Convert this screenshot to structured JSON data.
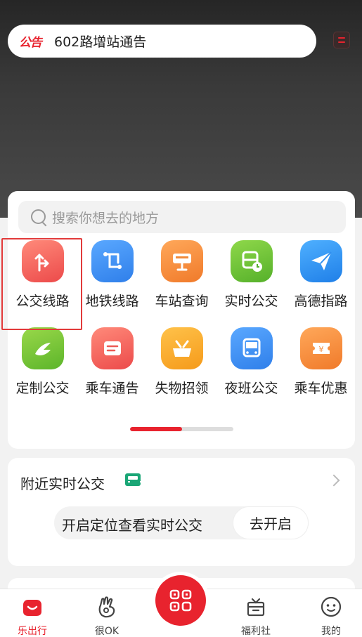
{
  "notice": {
    "tag": "公告",
    "text": "602路增站通告"
  },
  "search": {
    "placeholder": "搜索你想去的地方"
  },
  "services": [
    {
      "label": "公交线路",
      "icon": "route-icon",
      "color": "#f0605c"
    },
    {
      "label": "地铁线路",
      "icon": "metro-icon",
      "color": "#3f8ff0"
    },
    {
      "label": "车站查询",
      "icon": "station-icon",
      "color": "#f58a3a"
    },
    {
      "label": "实时公交",
      "icon": "realtime-bus-icon",
      "color": "#6cc23a"
    },
    {
      "label": "高德指路",
      "icon": "paper-plane-icon",
      "color": "#2f8ff0"
    },
    {
      "label": "定制公交",
      "icon": "custom-bus-icon",
      "color": "#7cc62a"
    },
    {
      "label": "乘车通告",
      "icon": "notice-board-icon",
      "color": "#f0605c"
    },
    {
      "label": "失物招领",
      "icon": "lost-found-icon",
      "color": "#f5a623"
    },
    {
      "label": "夜班公交",
      "icon": "night-bus-icon",
      "color": "#3f8ff0"
    },
    {
      "label": "乘车优惠",
      "icon": "coupon-icon",
      "color": "#f58a3a"
    }
  ],
  "pager": {
    "active_fraction": 0.5
  },
  "nearby": {
    "title": "附近实时公交",
    "locate_text": "开启定位查看实时公交",
    "locate_button": "去开启"
  },
  "tabbar": {
    "items": [
      {
        "label": "乐出行",
        "icon": "home-icon",
        "active": true
      },
      {
        "label": "很OK",
        "icon": "ok-hand-icon",
        "active": false
      },
      {
        "label": "",
        "icon": "qr-scan-icon",
        "active": false
      },
      {
        "label": "福利社",
        "icon": "gift-box-icon",
        "active": false
      },
      {
        "label": "我的",
        "icon": "profile-icon",
        "active": false
      }
    ]
  },
  "colors": {
    "brand_red": "#e8232e",
    "header_dark": "#2a2a2a"
  }
}
